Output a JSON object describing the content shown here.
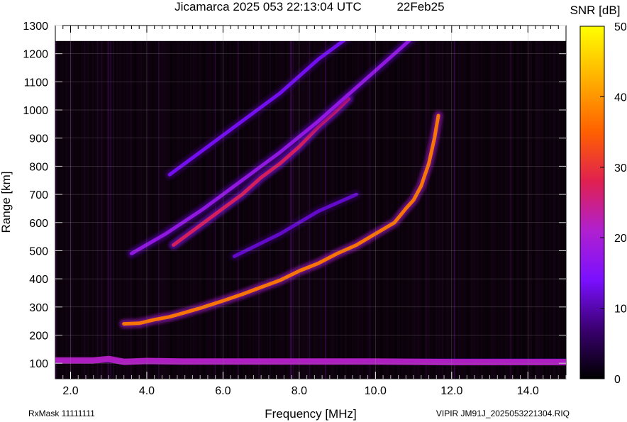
{
  "header": {
    "title": "Jicamarca 2025 053 22:13:04 UTC",
    "date": "22Feb25"
  },
  "footer": {
    "left": "RxMask 11111111",
    "right": "VIPIR  JM91J_2025053221304.RIQ"
  },
  "colors": {
    "background_plot": "#000000",
    "colormap": [
      "#000000",
      "#3a0070",
      "#7a10ff",
      "#b020d0",
      "#e02050",
      "#ff6000",
      "#ffb000",
      "#ffff00"
    ]
  },
  "chart_data": {
    "type": "heatmap",
    "title": "Jicamarca 2025 053 22:13:04 UTC",
    "xlabel": "Frequency [MHz]",
    "ylabel": "Range [km]",
    "xlim": [
      1.6,
      15.0
    ],
    "ylim": [
      45,
      1300
    ],
    "data_ylim_top": 1245,
    "xticks": [
      2.0,
      4.0,
      6.0,
      8.0,
      10.0,
      12.0,
      14.0
    ],
    "xtick_labels": [
      "2.0",
      "4.0",
      "6.0",
      "8.0",
      "10.0",
      "12.0",
      "14.0"
    ],
    "yticks": [
      100,
      200,
      300,
      400,
      500,
      600,
      700,
      800,
      900,
      1000,
      1100,
      1200,
      1300
    ],
    "ytick_labels": [
      "100",
      "200",
      "300",
      "400",
      "500",
      "600",
      "700",
      "800",
      "900",
      "1000",
      "1100",
      "1200",
      "1300"
    ],
    "grid": true,
    "colorbar": {
      "label": "SNR [dB]",
      "range": [
        0,
        50
      ],
      "ticks": [
        0,
        10,
        20,
        30,
        40,
        50
      ],
      "tick_labels": [
        "0",
        "10",
        "20",
        "30",
        "40",
        "50"
      ]
    },
    "traces": [
      {
        "id": "o-trace-1hop",
        "snr": 38,
        "points": [
          [
            3.4,
            240
          ],
          [
            3.8,
            242
          ],
          [
            4.2,
            255
          ],
          [
            4.6,
            265
          ],
          [
            5.0,
            280
          ],
          [
            5.5,
            300
          ],
          [
            6.0,
            322
          ],
          [
            6.5,
            345
          ],
          [
            7.0,
            370
          ],
          [
            7.5,
            395
          ],
          [
            8.0,
            428
          ],
          [
            8.5,
            455
          ],
          [
            9.0,
            490
          ],
          [
            9.5,
            520
          ],
          [
            10.0,
            560
          ],
          [
            10.5,
            600
          ],
          [
            10.8,
            650
          ],
          [
            11.0,
            680
          ],
          [
            11.2,
            730
          ],
          [
            11.4,
            810
          ],
          [
            11.55,
            900
          ],
          [
            11.65,
            980
          ]
        ]
      },
      {
        "id": "sporadic-e-base",
        "snr": 22,
        "points": [
          [
            1.6,
            110
          ],
          [
            2.6,
            110
          ],
          [
            3.0,
            115
          ],
          [
            3.4,
            105
          ],
          [
            4.0,
            108
          ],
          [
            5.0,
            106
          ],
          [
            7.0,
            106
          ],
          [
            10.0,
            106
          ],
          [
            12.0,
            104
          ],
          [
            15.0,
            104
          ]
        ]
      },
      {
        "id": "o-trace-2hop",
        "snr": 28,
        "points": [
          [
            4.7,
            520
          ],
          [
            5.5,
            600
          ],
          [
            6.0,
            650
          ],
          [
            6.5,
            700
          ],
          [
            7.0,
            760
          ],
          [
            7.5,
            810
          ],
          [
            8.0,
            870
          ],
          [
            8.5,
            940
          ],
          [
            9.0,
            1000
          ],
          [
            9.3,
            1040
          ]
        ]
      },
      {
        "id": "o-trace-2hop-upper",
        "snr": 18,
        "points": [
          [
            3.6,
            490
          ],
          [
            4.5,
            560
          ],
          [
            5.5,
            650
          ],
          [
            6.5,
            750
          ],
          [
            7.5,
            850
          ],
          [
            8.5,
            960
          ],
          [
            9.5,
            1080
          ],
          [
            10.5,
            1200
          ],
          [
            11.0,
            1260
          ]
        ]
      },
      {
        "id": "o-trace-3hop",
        "snr": 14,
        "points": [
          [
            4.6,
            770
          ],
          [
            5.5,
            860
          ],
          [
            6.5,
            960
          ],
          [
            7.5,
            1060
          ],
          [
            8.5,
            1180
          ],
          [
            9.3,
            1260
          ]
        ]
      },
      {
        "id": "x-trace-faint",
        "snr": 12,
        "points": [
          [
            6.3,
            480
          ],
          [
            7.5,
            560
          ],
          [
            8.5,
            640
          ],
          [
            9.5,
            700
          ]
        ]
      }
    ]
  }
}
